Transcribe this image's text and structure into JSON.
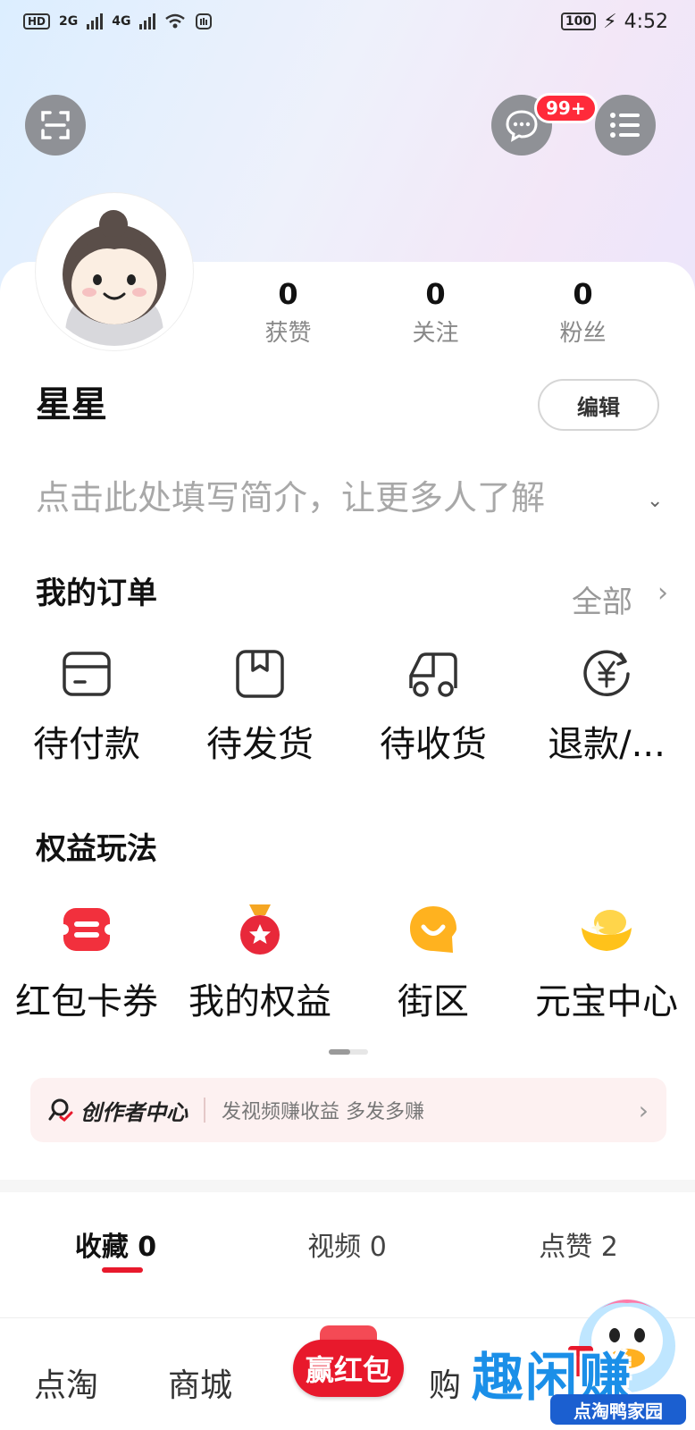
{
  "status_bar": {
    "hd": "HD",
    "net1": "2G",
    "net2": "4G",
    "battery": "100",
    "time": "4:52"
  },
  "header": {
    "scan_icon": "scan-icon",
    "message_icon": "chat-icon",
    "message_badge": "99+",
    "menu_icon": "menu-icon"
  },
  "profile": {
    "username": "星星",
    "edit_label": "编辑",
    "bio_placeholder": "点击此处填写简介，让更多人了解",
    "stats": [
      {
        "value": "0",
        "label": "获赞"
      },
      {
        "value": "0",
        "label": "关注"
      },
      {
        "value": "0",
        "label": "粉丝"
      }
    ]
  },
  "orders": {
    "title": "我的订单",
    "see_all": "全部",
    "items": [
      {
        "label": "待付款",
        "icon": "wallet-icon"
      },
      {
        "label": "待发货",
        "icon": "package-icon"
      },
      {
        "label": "待收货",
        "icon": "delivery-truck-icon"
      },
      {
        "label": "退款/...",
        "icon": "refund-icon"
      }
    ]
  },
  "benefits": {
    "title": "权益玩法",
    "items": [
      {
        "label": "红包卡券",
        "icon": "coupon-icon"
      },
      {
        "label": "我的权益",
        "icon": "medal-icon"
      },
      {
        "label": "街区",
        "icon": "smile-bubble-icon"
      },
      {
        "label": "元宝中心",
        "icon": "gold-ingot-icon"
      }
    ]
  },
  "creator_bar": {
    "brand": "创作者中心",
    "desc": "发视频赚收益 多发多赚"
  },
  "content_tabs": [
    {
      "label": "收藏 0"
    },
    {
      "label": "视频 0"
    },
    {
      "label": "点赞 2"
    }
  ],
  "bottom_nav": {
    "items": [
      "点淘",
      "商城",
      "购"
    ],
    "hongbao": "赢红包"
  },
  "promo": {
    "title": "趣闲赚",
    "subtitle": "点淘鸭家园"
  },
  "colors": {
    "accent_red": "#e8192c",
    "badge_red": "#ff2a3a",
    "promo_blue": "#1b8fe8"
  }
}
